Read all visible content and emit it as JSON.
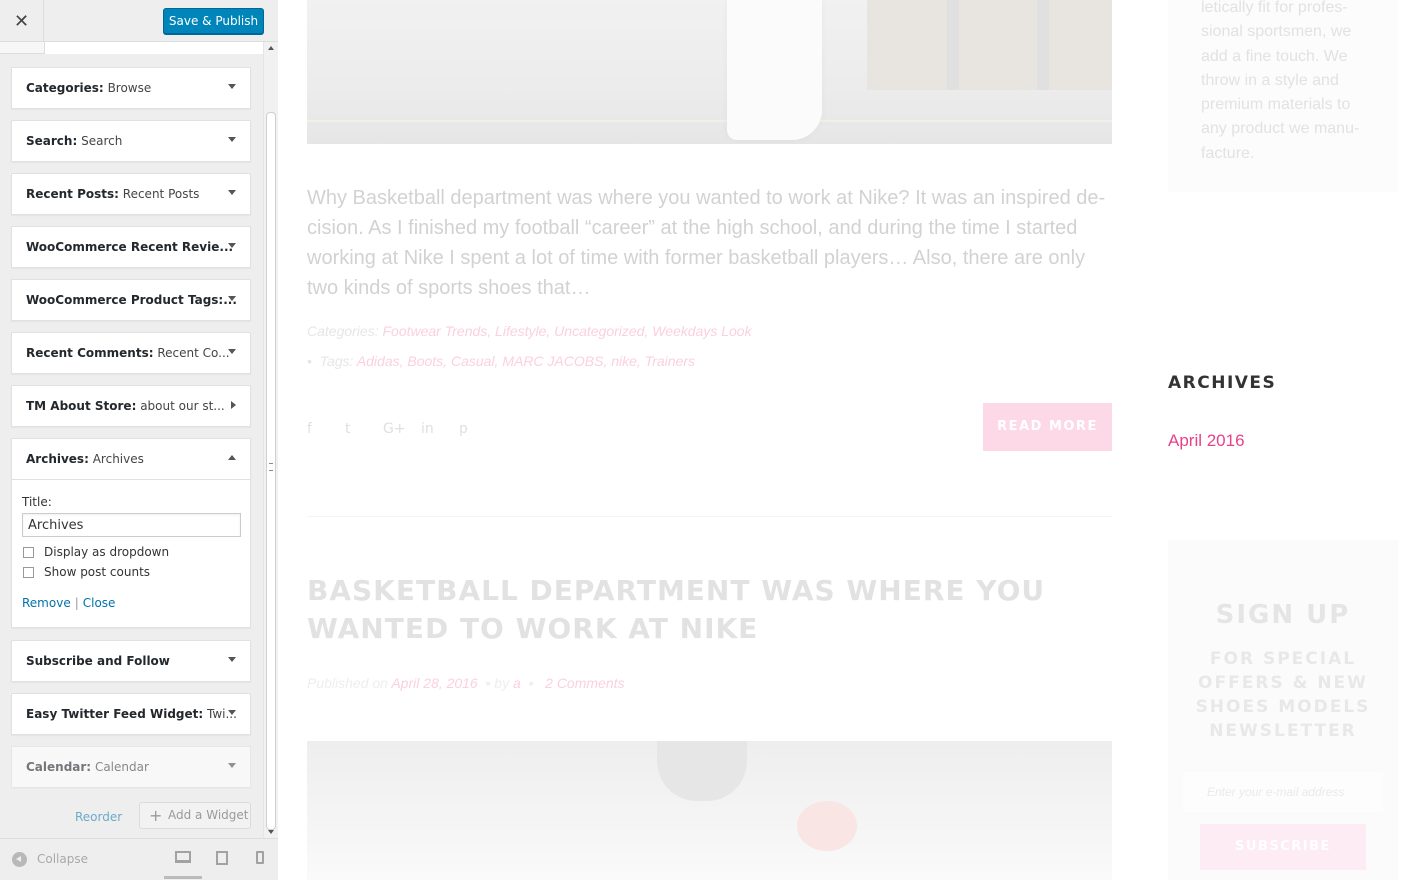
{
  "customizer": {
    "close_symbol": "✕",
    "publish_label": "Save & Publish",
    "widgets": [
      {
        "name": "Categories:",
        "sub": "Browse"
      },
      {
        "name": "Search:",
        "sub": "Search"
      },
      {
        "name": "Recent Posts:",
        "sub": "Recent Posts"
      },
      {
        "name": "WooCommerce Recent Revie...",
        "sub": ""
      },
      {
        "name": "WooCommerce Product Tags:...",
        "sub": ""
      },
      {
        "name": "Recent Comments:",
        "sub": "Recent Co..."
      },
      {
        "name": "TM About Store:",
        "sub": "about our st..."
      },
      {
        "name": "Archives:",
        "sub": "Archives"
      },
      {
        "name": "Subscribe and Follow",
        "sub": ""
      },
      {
        "name": "Easy Twitter Feed Widget:",
        "sub": "Twi..."
      },
      {
        "name": "Calendar:",
        "sub": "Calendar"
      }
    ],
    "archives_form": {
      "title_label": "Title:",
      "title_value": "Archives",
      "dropdown_label": "Display as dropdown",
      "counts_label": "Show post counts",
      "remove_label": "Remove",
      "separator": "|",
      "close_label": "Close"
    },
    "reorder_label": "Reorder",
    "add_widget_label": "Add a Widget",
    "collapse_label": "Collapse"
  },
  "preview": {
    "excerpt": "Why Basketball department was where you wanted to work at Nike? It was an inspired de­cision. As I finished my football “career” at the high school, and during the time I started working at Nike I spent a lot of time with former basketball players… Also, there are only two kinds of sports shoes that…",
    "categories_label": "Categories:",
    "categories": "Footwear Trends, Lifestyle, Uncategorized, Weekdays Look",
    "tags_bullet": "•",
    "tags_label": "Tags:",
    "tags": "Adidas, Boots, Casual, MARC JACOBS, nike, Trainers",
    "social_icons": [
      "f",
      "t",
      "G+",
      "in",
      "p"
    ],
    "read_more": "READ MORE",
    "post_title": "BASKETBALL DEPARTMENT WAS WHERE YOU WANTED TO WORK AT NIKE",
    "published_label": "Published on",
    "published_date": "April 28, 2016",
    "by_label": "•  by",
    "author": "a",
    "bullet": "•",
    "comments": "2 Comments",
    "about_text": "letically fit for profes­sional sportsmen, we add a fine touch. We throw in a style and premium materials to any product we manu­facture.",
    "archives_heading": "ARCHIVES",
    "archives_link": "April 2016",
    "signup_title": "SIGN UP",
    "signup_sub": "FOR SPECIAL OFFERS & NEW SHOES MODELS NEWSLETTER",
    "email_placeholder": "Enter your e-mail address",
    "subscribe_label": "SUBSCRIBE"
  },
  "colors": {
    "publish_button": "#0085ba",
    "link_blue": "#0073aa",
    "accent_pink": "#e6428a",
    "read_more_bg": "#fdd9e8"
  },
  "icons": {
    "close": "close-icon",
    "add": "plus-icon",
    "collapse": "collapse-icon",
    "devices": [
      "desktop-icon",
      "tablet-icon",
      "mobile-icon"
    ],
    "social": [
      "facebook-icon",
      "twitter-icon",
      "google-plus-icon",
      "linkedin-icon",
      "pinterest-icon"
    ]
  }
}
